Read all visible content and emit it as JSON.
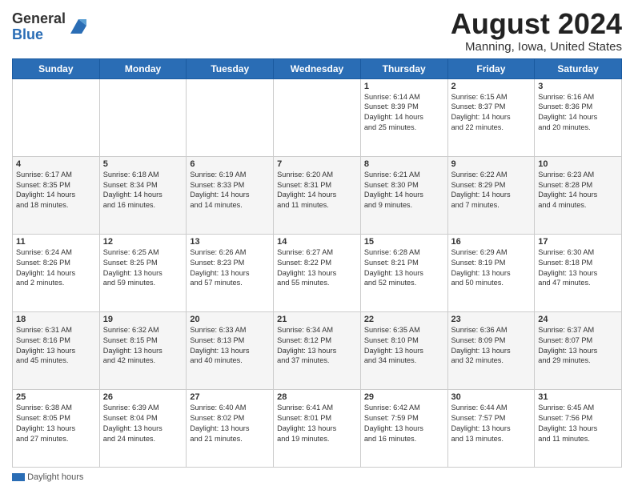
{
  "header": {
    "logo_general": "General",
    "logo_blue": "Blue",
    "month_title": "August 2024",
    "location": "Manning, Iowa, United States"
  },
  "footer": {
    "daylight_label": "Daylight hours"
  },
  "weekdays": [
    "Sunday",
    "Monday",
    "Tuesday",
    "Wednesday",
    "Thursday",
    "Friday",
    "Saturday"
  ],
  "weeks": [
    [
      {
        "day": "",
        "info": ""
      },
      {
        "day": "",
        "info": ""
      },
      {
        "day": "",
        "info": ""
      },
      {
        "day": "",
        "info": ""
      },
      {
        "day": "1",
        "info": "Sunrise: 6:14 AM\nSunset: 8:39 PM\nDaylight: 14 hours\nand 25 minutes."
      },
      {
        "day": "2",
        "info": "Sunrise: 6:15 AM\nSunset: 8:37 PM\nDaylight: 14 hours\nand 22 minutes."
      },
      {
        "day": "3",
        "info": "Sunrise: 6:16 AM\nSunset: 8:36 PM\nDaylight: 14 hours\nand 20 minutes."
      }
    ],
    [
      {
        "day": "4",
        "info": "Sunrise: 6:17 AM\nSunset: 8:35 PM\nDaylight: 14 hours\nand 18 minutes."
      },
      {
        "day": "5",
        "info": "Sunrise: 6:18 AM\nSunset: 8:34 PM\nDaylight: 14 hours\nand 16 minutes."
      },
      {
        "day": "6",
        "info": "Sunrise: 6:19 AM\nSunset: 8:33 PM\nDaylight: 14 hours\nand 14 minutes."
      },
      {
        "day": "7",
        "info": "Sunrise: 6:20 AM\nSunset: 8:31 PM\nDaylight: 14 hours\nand 11 minutes."
      },
      {
        "day": "8",
        "info": "Sunrise: 6:21 AM\nSunset: 8:30 PM\nDaylight: 14 hours\nand 9 minutes."
      },
      {
        "day": "9",
        "info": "Sunrise: 6:22 AM\nSunset: 8:29 PM\nDaylight: 14 hours\nand 7 minutes."
      },
      {
        "day": "10",
        "info": "Sunrise: 6:23 AM\nSunset: 8:28 PM\nDaylight: 14 hours\nand 4 minutes."
      }
    ],
    [
      {
        "day": "11",
        "info": "Sunrise: 6:24 AM\nSunset: 8:26 PM\nDaylight: 14 hours\nand 2 minutes."
      },
      {
        "day": "12",
        "info": "Sunrise: 6:25 AM\nSunset: 8:25 PM\nDaylight: 13 hours\nand 59 minutes."
      },
      {
        "day": "13",
        "info": "Sunrise: 6:26 AM\nSunset: 8:23 PM\nDaylight: 13 hours\nand 57 minutes."
      },
      {
        "day": "14",
        "info": "Sunrise: 6:27 AM\nSunset: 8:22 PM\nDaylight: 13 hours\nand 55 minutes."
      },
      {
        "day": "15",
        "info": "Sunrise: 6:28 AM\nSunset: 8:21 PM\nDaylight: 13 hours\nand 52 minutes."
      },
      {
        "day": "16",
        "info": "Sunrise: 6:29 AM\nSunset: 8:19 PM\nDaylight: 13 hours\nand 50 minutes."
      },
      {
        "day": "17",
        "info": "Sunrise: 6:30 AM\nSunset: 8:18 PM\nDaylight: 13 hours\nand 47 minutes."
      }
    ],
    [
      {
        "day": "18",
        "info": "Sunrise: 6:31 AM\nSunset: 8:16 PM\nDaylight: 13 hours\nand 45 minutes."
      },
      {
        "day": "19",
        "info": "Sunrise: 6:32 AM\nSunset: 8:15 PM\nDaylight: 13 hours\nand 42 minutes."
      },
      {
        "day": "20",
        "info": "Sunrise: 6:33 AM\nSunset: 8:13 PM\nDaylight: 13 hours\nand 40 minutes."
      },
      {
        "day": "21",
        "info": "Sunrise: 6:34 AM\nSunset: 8:12 PM\nDaylight: 13 hours\nand 37 minutes."
      },
      {
        "day": "22",
        "info": "Sunrise: 6:35 AM\nSunset: 8:10 PM\nDaylight: 13 hours\nand 34 minutes."
      },
      {
        "day": "23",
        "info": "Sunrise: 6:36 AM\nSunset: 8:09 PM\nDaylight: 13 hours\nand 32 minutes."
      },
      {
        "day": "24",
        "info": "Sunrise: 6:37 AM\nSunset: 8:07 PM\nDaylight: 13 hours\nand 29 minutes."
      }
    ],
    [
      {
        "day": "25",
        "info": "Sunrise: 6:38 AM\nSunset: 8:05 PM\nDaylight: 13 hours\nand 27 minutes."
      },
      {
        "day": "26",
        "info": "Sunrise: 6:39 AM\nSunset: 8:04 PM\nDaylight: 13 hours\nand 24 minutes."
      },
      {
        "day": "27",
        "info": "Sunrise: 6:40 AM\nSunset: 8:02 PM\nDaylight: 13 hours\nand 21 minutes."
      },
      {
        "day": "28",
        "info": "Sunrise: 6:41 AM\nSunset: 8:01 PM\nDaylight: 13 hours\nand 19 minutes."
      },
      {
        "day": "29",
        "info": "Sunrise: 6:42 AM\nSunset: 7:59 PM\nDaylight: 13 hours\nand 16 minutes."
      },
      {
        "day": "30",
        "info": "Sunrise: 6:44 AM\nSunset: 7:57 PM\nDaylight: 13 hours\nand 13 minutes."
      },
      {
        "day": "31",
        "info": "Sunrise: 6:45 AM\nSunset: 7:56 PM\nDaylight: 13 hours\nand 11 minutes."
      }
    ]
  ]
}
